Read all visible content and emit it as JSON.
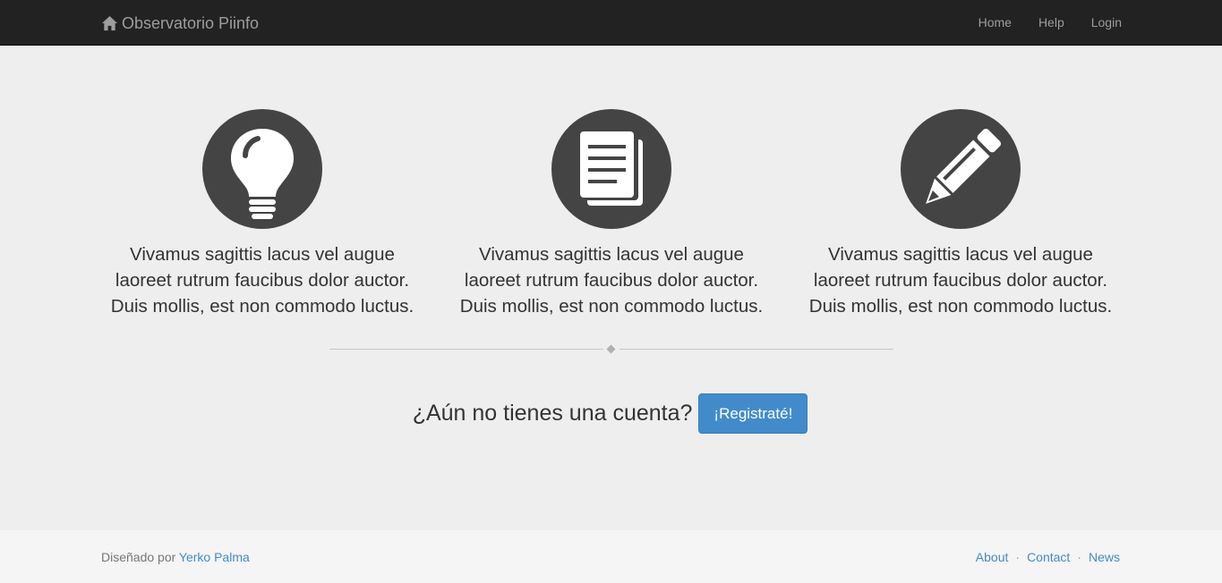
{
  "navbar": {
    "brand": "Observatorio Piinfo",
    "brand_icon": "home-icon",
    "links": [
      "Home",
      "Help",
      "Login"
    ]
  },
  "features": [
    {
      "icon": "lightbulb-icon",
      "text": "Vivamus sagittis lacus vel augue laoreet rutrum faucibus dolor auctor. Duis mollis, est non commodo luctus."
    },
    {
      "icon": "document-icon",
      "text": "Vivamus sagittis lacus vel augue laoreet rutrum faucibus dolor auctor. Duis mollis, est non commodo luctus."
    },
    {
      "icon": "pencil-icon",
      "text": "Vivamus sagittis lacus vel augue laoreet rutrum faucibus dolor auctor. Duis mollis, est non commodo luctus."
    }
  ],
  "cta": {
    "question": "¿Aún no tienes una cuenta?",
    "button": "¡Registraté!"
  },
  "footer": {
    "designed_by": "Diseñado por",
    "author": "Yerko Palma",
    "links": [
      "About",
      "Contact",
      "News"
    ],
    "separator": "·"
  },
  "colors": {
    "navbar_bg": "#222222",
    "accent": "#428bca",
    "icon_circle": "#444444",
    "page_bg": "#eeeeee"
  }
}
